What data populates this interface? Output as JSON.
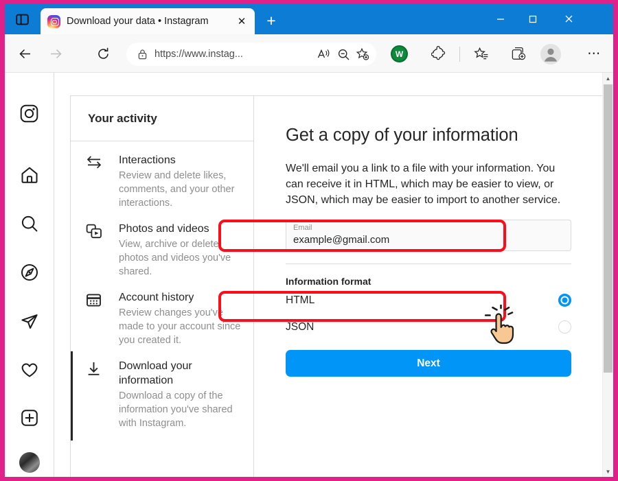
{
  "browser": {
    "tablist_icon": "split-pane-icon",
    "tab": {
      "title": "Download your data • Instagram",
      "favicon": "instagram-favicon",
      "close_label": "✕"
    },
    "newtab_label": "+",
    "window_controls": {
      "minimize": "—",
      "maximize": "▢",
      "close": "✕"
    },
    "nav": {
      "back": "back-arrow-icon",
      "forward": "forward-arrow-icon",
      "reload": "reload-icon"
    },
    "omnibox": {
      "lock": "lock-icon",
      "url": "https://www.instag...",
      "read_aloud": "read-aloud-icon",
      "zoom_out": "zoom-out-icon",
      "add_favorite": "add-favorite-star-icon"
    },
    "toolbar_icons": {
      "extension_badge": "W",
      "extensions": "puzzle-piece-icon",
      "favorites": "favorites-star-icon",
      "collections": "collections-icon",
      "profile": "profile-avatar-icon",
      "more": "⋯"
    },
    "scrollbar": {
      "up": "▲",
      "down": "▼"
    }
  },
  "instagram_rail": {
    "items": [
      {
        "name": "instagram-logo",
        "label": "Instagram"
      },
      {
        "name": "home-icon",
        "label": "Home"
      },
      {
        "name": "search-icon",
        "label": "Search"
      },
      {
        "name": "explore-compass-icon",
        "label": "Explore"
      },
      {
        "name": "messenger-send-icon",
        "label": "Messages"
      },
      {
        "name": "heart-icon",
        "label": "Notifications"
      },
      {
        "name": "plus-square-icon",
        "label": "Create"
      },
      {
        "name": "profile-avatar",
        "label": "Profile"
      }
    ]
  },
  "activity": {
    "title": "Your activity",
    "items": [
      {
        "icon": "interactions-arrows-icon",
        "title": "Interactions",
        "desc": "Review and delete likes, comments, and your other interactions.",
        "active": false
      },
      {
        "icon": "photos-videos-icon",
        "title": "Photos and videos",
        "desc": "View, archive or delete photos and videos you've shared.",
        "active": false
      },
      {
        "icon": "calendar-icon",
        "title": "Account history",
        "desc": "Review changes you've made to your account since you created it.",
        "active": false
      },
      {
        "icon": "download-arrow-icon",
        "title": "Download your information",
        "desc": "Download a copy of the information you've shared with Instagram.",
        "active": true
      }
    ]
  },
  "main": {
    "title": "Get a copy of your information",
    "description": "We'll email you a link to a file with your information. You can receive it in HTML, which may be easier to view, or JSON, which may be easier to import to another service.",
    "email": {
      "label": "Email",
      "value": "example@gmail.com",
      "placeholder": "Email"
    },
    "format": {
      "label": "Information format",
      "options": [
        {
          "label": "HTML",
          "selected": true
        },
        {
          "label": "JSON",
          "selected": false
        }
      ]
    },
    "next_label": "Next"
  },
  "annotations": {
    "color": "#fc0d1b",
    "frame_color": "#e0218a",
    "boxes": [
      {
        "name": "email-highlight"
      },
      {
        "name": "format-highlight"
      }
    ],
    "cursor": "hand-pointer-click-cursor"
  },
  "colors": {
    "accent_blue": "#0095f6",
    "titlebar_blue": "#0c7cd5",
    "text_primary": "#262626",
    "text_secondary": "#8e8e8e"
  }
}
